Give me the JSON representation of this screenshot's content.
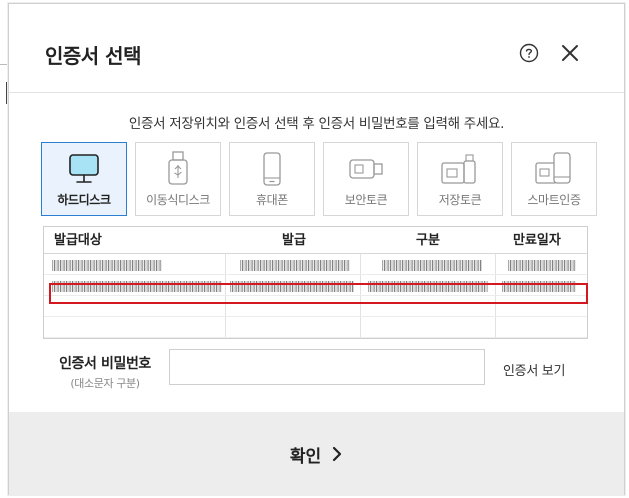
{
  "dialog": {
    "title": "인증서 선택",
    "help_icon": "question-circle-icon",
    "close_icon": "close-x-icon"
  },
  "instruction": "인증서 저장위치와 인증서 선택 후 인증서 비밀번호를 입력해 주세요.",
  "media": [
    {
      "label": "하드디스크",
      "icon": "monitor-icon",
      "selected": true
    },
    {
      "label": "이동식디스크",
      "icon": "usb-drive-icon",
      "selected": false
    },
    {
      "label": "휴대폰",
      "icon": "phone-icon",
      "selected": false
    },
    {
      "label": "보안토큰",
      "icon": "security-token-icon",
      "selected": false
    },
    {
      "label": "저장토큰",
      "icon": "storage-token-icon",
      "selected": false
    },
    {
      "label": "스마트인증",
      "icon": "smart-cert-icon",
      "selected": false
    }
  ],
  "table": {
    "headers": [
      "발급대상",
      "발급",
      "구분",
      "만료일자"
    ]
  },
  "password": {
    "label": "인증서 비밀번호",
    "sub_label": "(대소문자 구분)",
    "value": ""
  },
  "view_cert_label": "인증서 보기",
  "confirm_label": "확인",
  "colors": {
    "selected_border": "#2a7fd4",
    "selected_bg": "#eaf3fd",
    "highlight": "#d4181f",
    "footer_bg": "#ededed"
  }
}
